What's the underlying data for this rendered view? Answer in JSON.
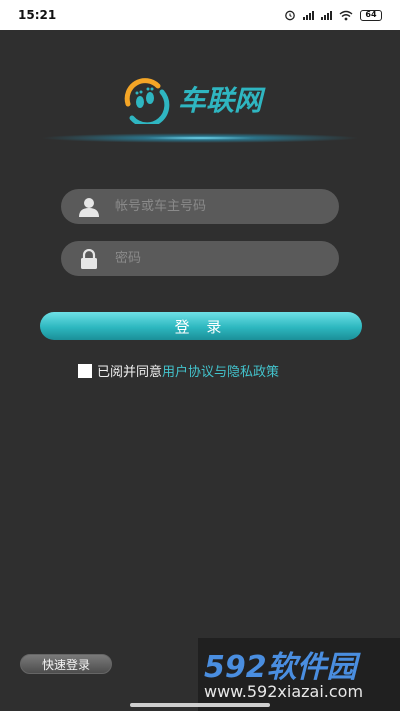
{
  "status_bar": {
    "time": "15:21",
    "battery": "64"
  },
  "logo": {
    "text": "车联网"
  },
  "form": {
    "account_placeholder": "帐号或车主号码",
    "password_placeholder": "密码",
    "login_label": "登 录"
  },
  "agreement": {
    "prefix": "已阅并同意",
    "link": "用户协议与隐私政策"
  },
  "quick_login_label": "快速登录",
  "watermark": {
    "main": "592软件园",
    "sub": "www.592xiazai.com"
  },
  "colors": {
    "accent": "#2fb6c1",
    "background": "#2f2f2f",
    "field": "#5a5a5a"
  }
}
